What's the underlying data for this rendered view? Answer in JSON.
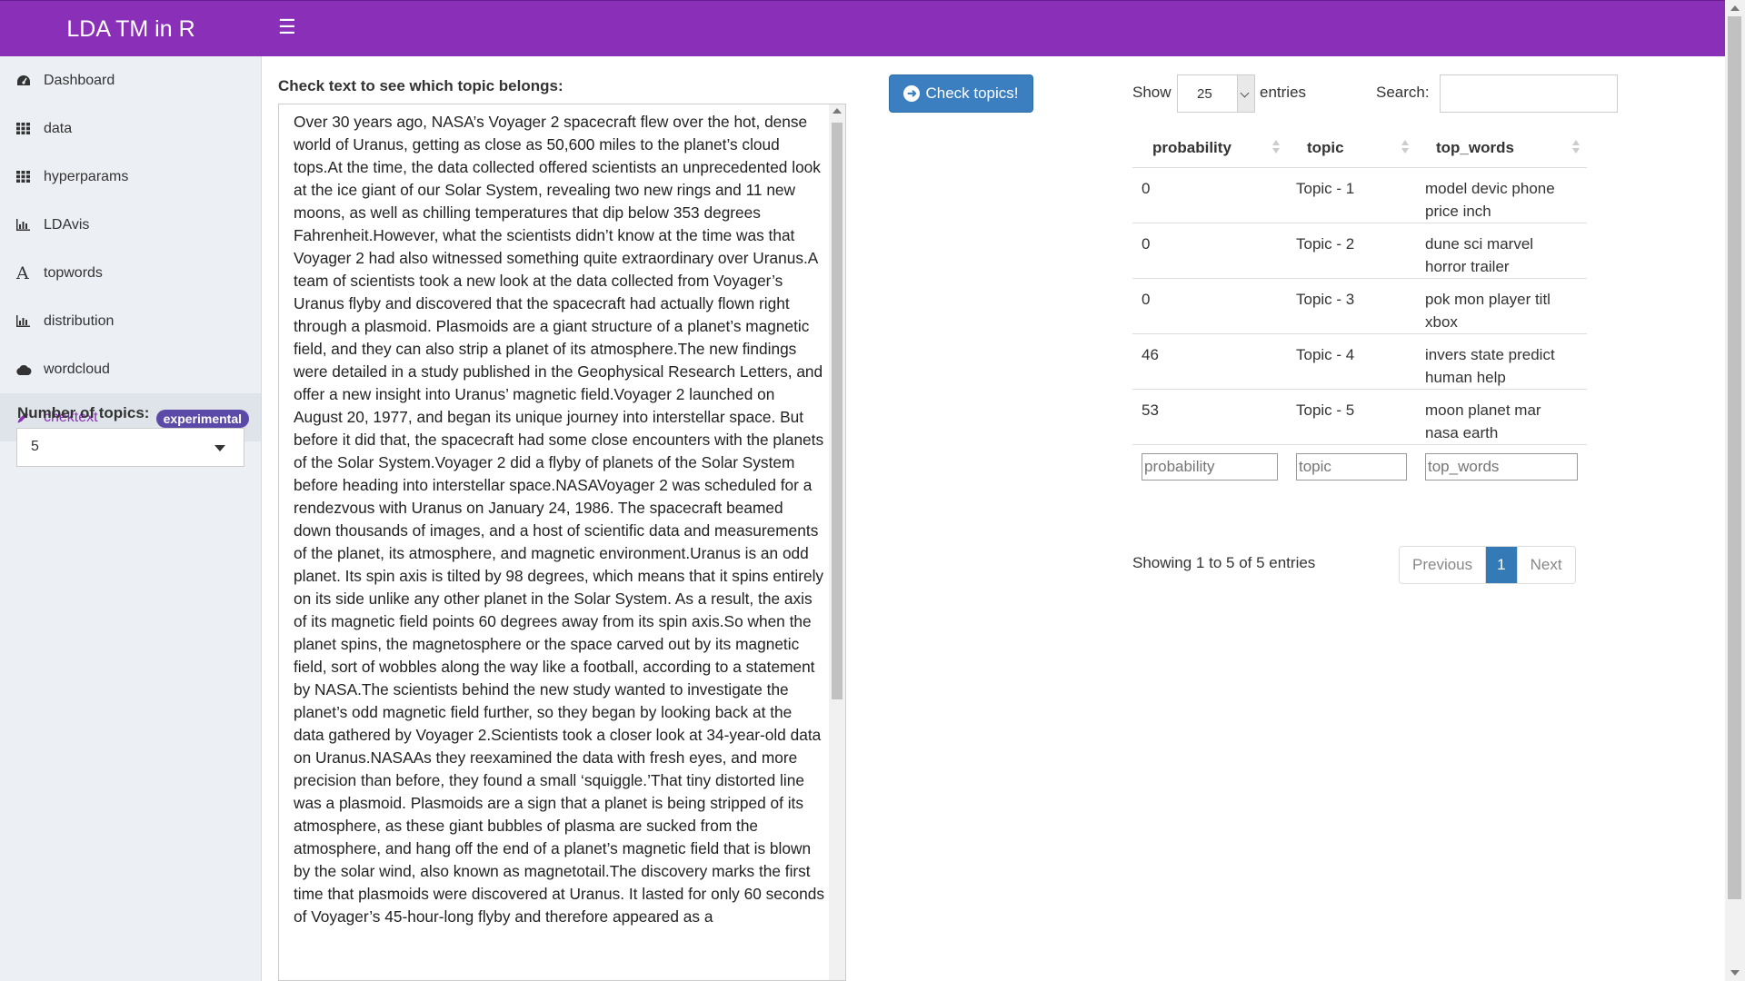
{
  "header": {
    "title": "LDA TM in R"
  },
  "sidebar": {
    "items": [
      {
        "label": "Dashboard",
        "icon": "dashboard-icon"
      },
      {
        "label": "data",
        "icon": "grid-icon"
      },
      {
        "label": "hyperparams",
        "icon": "grid-icon"
      },
      {
        "label": "LDAvis",
        "icon": "bar-chart-icon"
      },
      {
        "label": "topwords",
        "icon": "font-icon"
      },
      {
        "label": "distribution",
        "icon": "bar-chart-icon"
      },
      {
        "label": "wordcloud",
        "icon": "cloud-icon"
      },
      {
        "label": "chektext",
        "icon": "pencil-icon",
        "badge": "experimental",
        "active": true
      }
    ],
    "topics_label": "Number of topics:",
    "topics_value": "5"
  },
  "main": {
    "check_label": "Check text to see which topic belongs:",
    "text": "Over 30 years ago, NASA’s Voyager 2 spacecraft flew over the hot, dense world of Uranus, getting as close as 50,600 miles to the planet’s cloud tops.At the time, the data collected offered scientists an unprecedented look at the ice giant of our Solar System, revealing two new rings and 11 new moons, as well as chilling temperatures that dip below 353 degrees Fahrenheit.However, what the scientists didn’t know at the time was that Voyager 2 had also witnessed something quite extraordinary over Uranus.A team of scientists took a new look at the data collected from Voyager’s Uranus flyby and discovered that the spacecraft had actually flown right through a plasmoid. Plasmoids are a giant structure of a planet’s magnetic field, and they can also strip a planet of its atmosphere.The new findings were detailed in a study published in the Geophysical Research Letters, and offer a new insight into Uranus’ magnetic field.Voyager 2 launched on August 20, 1977, and began its unique journey into interstellar space. But before it did that, the spacecraft had some close encounters with the planets of the Solar System.Voyager 2 did a flyby of planets of the Solar System before heading into interstellar space.NASAVoyager 2 was scheduled for a rendezvous with Uranus on January 24, 1986. The spacecraft beamed down thousands of images, and a host of scientific data and measurements of the planet, its atmosphere, and magnetic environment.Uranus is an odd planet. Its spin axis is tilted by 98 degrees, which means that it spins entirely on its side unlike any other planet in the Solar System. As a result, the axis of its magnetic field points 60 degrees away from its spin axis.So when the planet spins, the magnetosphere or the space carved out by its magnetic field, sort of wobbles along the way like a football, according to a statement by NASA.The scientists behind the new study wanted to investigate the planet’s odd magnetic field further, so they began by looking back at the data gathered by Voyager 2.Scientists took a closer look at 34-year-old data on Uranus.NASAAs they reexamined the data with fresh eyes, and more precision than before, they found a small ‘squiggle.’That tiny distorted line was a plasmoid. Plasmoids are a sign that a planet is being stripped of its atmosphere, as these giant bubbles of plasma are sucked from the atmosphere, and hang off the end of a planet’s magnetic field that is blown by the solar wind, also known as magnetotail.The discovery marks the first time that plasmoids were discovered at Uranus. It lasted for only 60 seconds of Voyager’s 45-hour-long flyby and therefore appeared as a",
    "check_button": "Check topics!"
  },
  "table": {
    "show_label": "Show",
    "length_value": "25",
    "entries_label": "entries",
    "search_label": "Search:",
    "columns": [
      "probability",
      "topic",
      "top_words"
    ],
    "rows": [
      {
        "probability": "0",
        "topic": "Topic - 1",
        "top_words": "model devic phone price inch"
      },
      {
        "probability": "0",
        "topic": "Topic - 2",
        "top_words": "dune sci marvel horror trailer"
      },
      {
        "probability": "0",
        "topic": "Topic - 3",
        "top_words": "pok mon player titl xbox"
      },
      {
        "probability": "46",
        "topic": "Topic - 4",
        "top_words": "invers state predict human help"
      },
      {
        "probability": "53",
        "topic": "Topic - 5",
        "top_words": "moon planet mar nasa earth"
      }
    ],
    "filter_placeholders": [
      "probability",
      "topic",
      "top_words"
    ],
    "info": "Showing 1 to 5 of 5 entries",
    "pager": {
      "previous": "Previous",
      "current": "1",
      "next": "Next"
    }
  },
  "colors": {
    "header": "#8a2fb8",
    "badge": "#5b4aa8",
    "button": "#3c7fc1",
    "pager_active": "#337ab7"
  }
}
